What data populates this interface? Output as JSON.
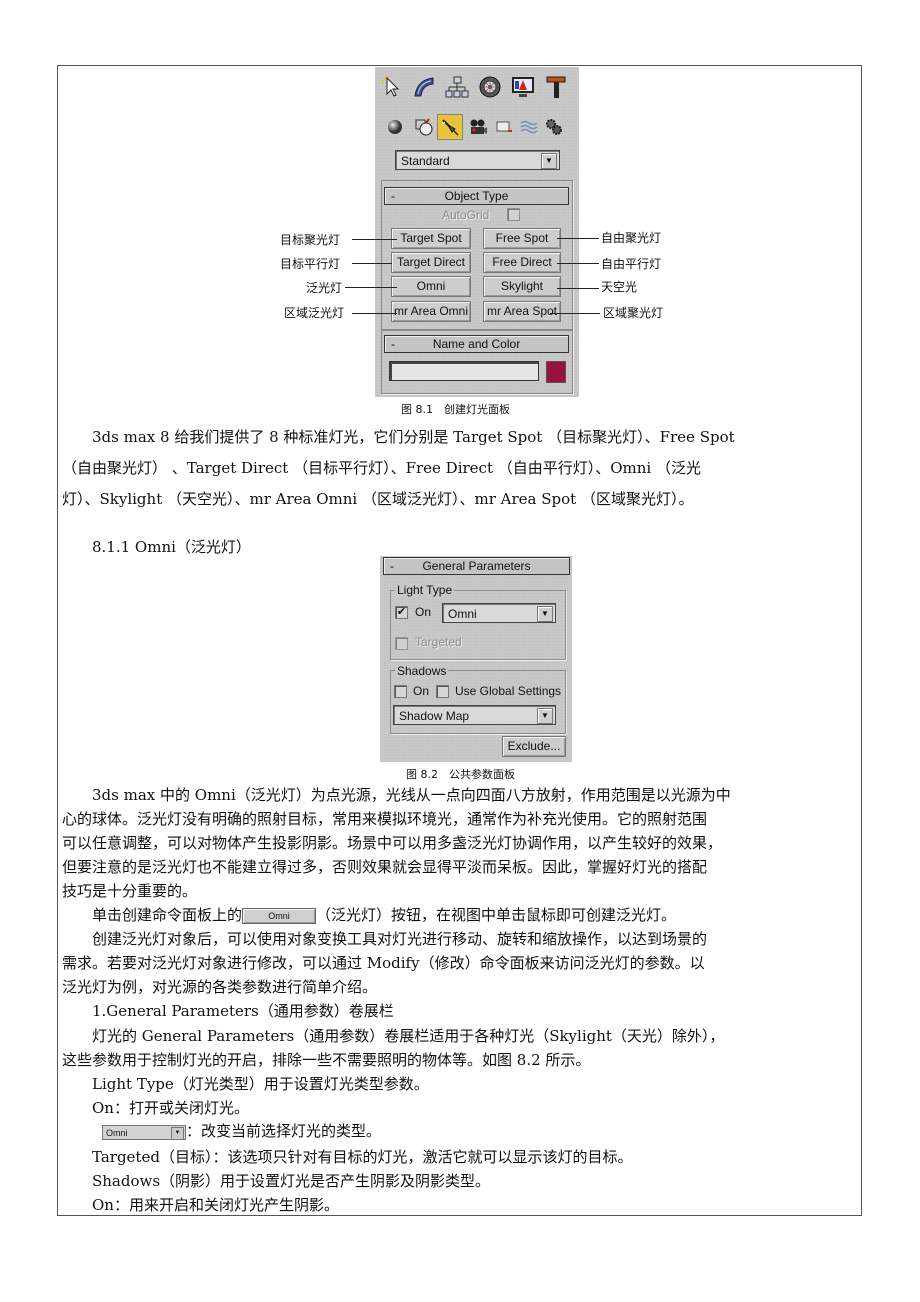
{
  "figure1": {
    "panel": {
      "tabs": [
        {
          "icon": "create-icon"
        },
        {
          "icon": "modify-icon"
        },
        {
          "icon": "hierarchy-icon"
        },
        {
          "icon": "motion-icon"
        },
        {
          "icon": "display-icon"
        },
        {
          "icon": "utilities-icon"
        }
      ],
      "categories": [
        {
          "icon": "geometry-icon"
        },
        {
          "icon": "shapes-icon"
        },
        {
          "icon": "lights-icon",
          "active": true
        },
        {
          "icon": "cameras-icon"
        },
        {
          "icon": "helpers-icon"
        },
        {
          "icon": "space-warps-icon"
        },
        {
          "icon": "systems-icon"
        }
      ],
      "type_dropdown": "Standard",
      "object_type": {
        "header": "Object Type",
        "collapse": "-",
        "autogrid": "AutoGrid",
        "buttons": [
          "Target Spot",
          "Free Spot",
          "Target Direct",
          "Free Direct",
          "Omni",
          "Skylight",
          "mr Area Omni",
          "mr Area Spot"
        ]
      },
      "name_and_color": {
        "header": "Name and Color",
        "collapse": "-",
        "name_value": "",
        "color": "#9a1040"
      }
    },
    "annotations_left": [
      "目标聚光灯",
      "目标平行灯",
      "泛光灯",
      "区域泛光灯"
    ],
    "annotations_right": [
      "自由聚光灯",
      "自由平行灯",
      "天空光",
      "区域聚光灯"
    ],
    "caption": "图 8.1　创建灯光面板"
  },
  "intro_lines": [
    "　　3ds max 8 给我们提供了 8 种标准灯光，它们分别是 Target Spot （目标聚光灯）、Free Spot",
    "（自由聚光灯） 、Target Direct （目标平行灯）、Free Direct （自由平行灯）、Omni （泛光",
    "灯）、Skylight （天空光）、mr Area Omni （区域泛光灯）、mr Area Spot （区域聚光灯）。"
  ],
  "section_heading": "　　8.1.1 Omni（泛光灯）",
  "figure2": {
    "header": "General Parameters",
    "collapse": "-",
    "light_type": {
      "group_label": "Light Type",
      "on_label": "On",
      "on_checked": true,
      "type_value": "Omni",
      "targeted_label": "Targeted",
      "targeted_checked": false
    },
    "shadows": {
      "group_label": "Shadows",
      "on_label": "On",
      "on_checked": false,
      "global_label": "Use Global Settings",
      "global_checked": false,
      "type_value": "Shadow Map"
    },
    "exclude_button": "Exclude...",
    "caption": "图 8.2　公共参数面板"
  },
  "body_lines": [
    "　　3ds max 中的 Omni（泛光灯）为点光源，光线从一点向四面八方放射，作用范围是以光源为中",
    "心的球体。泛光灯没有明确的照射目标，常用来模拟环境光，通常作为补充光使用。它的照射范围",
    "可以任意调整，可以对物体产生投影阴影。场景中可以用多盏泛光灯协调作用，以产生较好的效果，",
    "但要注意的是泛光灯也不能建立得过多，否则效果就会显得平淡而呆板。因此，掌握好灯光的搭配",
    "技巧是十分重要的。"
  ],
  "click_line": {
    "before": "　　单击创建命令面板上的",
    "button": "Omni",
    "after": "（泛光灯）按钮，在视图中单击鼠标即可创建泛光灯。"
  },
  "more_lines": [
    "　　创建泛光灯对象后，可以使用对象变换工具对灯光进行移动、旋转和缩放操作，以达到场景的",
    "需求。若要对泛光灯对象进行修改，可以通过 Modify（修改）命令面板来访问泛光灯的参数。以",
    "泛光灯为例，对光源的各类参数进行简单介绍。",
    "　　1.General Parameters（通用参数）卷展栏",
    "　　灯光的 General Parameters（通用参数）卷展栏适用于各种灯光（Skylight（天光）除外），",
    "这些参数用于控制灯光的开启，排除一些不需要照明的物体等。如图 8.2 所示。",
    "　　Light Type（灯光类型）用于设置灯光类型参数。",
    "　　On：打开或关闭灯光。"
  ],
  "dropdown_line": {
    "dropdown": "Omni",
    "after": "：改变当前选择灯光的类型。"
  },
  "tail_lines": [
    "　　Targeted（目标）：该选项只针对有目标的灯光，激活它就可以显示该灯的目标。",
    "　　Shadows（阴影）用于设置灯光是否产生阴影及阴影类型。",
    "　　On：用来开启和关闭灯光产生阴影。"
  ]
}
